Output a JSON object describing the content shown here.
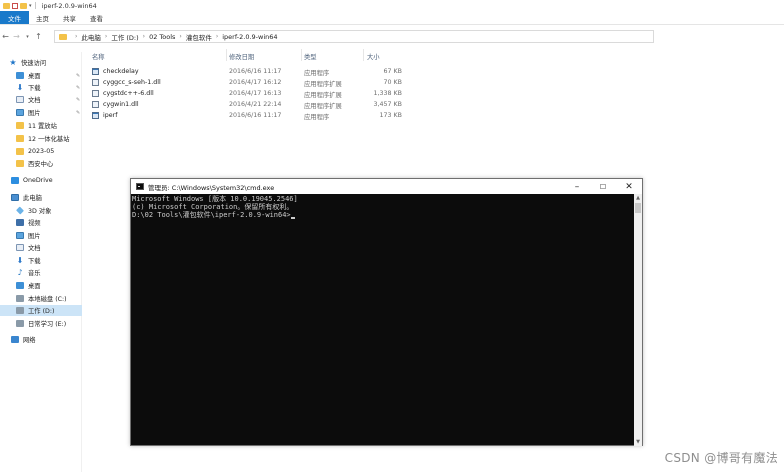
{
  "window": {
    "title": "iperf-2.0.9-win64"
  },
  "ribbon": {
    "tabs": [
      "文件",
      "主页",
      "共享",
      "查看"
    ]
  },
  "address": {
    "crumbs": [
      "此电脑",
      "工作 (D:)",
      "02 Tools",
      "灌包软件",
      "iperf-2.0.9-win64"
    ]
  },
  "sidebar": {
    "items": [
      {
        "label": "快速访问",
        "icon": "star-icon"
      },
      {
        "label": "桌面",
        "icon": "desktop-icon",
        "pinned": true
      },
      {
        "label": "下载",
        "icon": "download-icon",
        "pinned": true
      },
      {
        "label": "文档",
        "icon": "document-icon",
        "pinned": true
      },
      {
        "label": "图片",
        "icon": "picture-icon",
        "pinned": true
      },
      {
        "label": "11 置放站",
        "icon": "folder-icon"
      },
      {
        "label": "12 一体化基站",
        "icon": "folder-icon"
      },
      {
        "label": "2023-05",
        "icon": "folder-icon"
      },
      {
        "label": "西安中心",
        "icon": "folder-icon"
      },
      {
        "label": "OneDrive",
        "icon": "cloud-icon"
      },
      {
        "label": "此电脑",
        "icon": "computer-icon"
      },
      {
        "label": "3D 对象",
        "icon": "3d-objects-icon"
      },
      {
        "label": "视频",
        "icon": "video-icon"
      },
      {
        "label": "图片",
        "icon": "picture-icon"
      },
      {
        "label": "文档",
        "icon": "document-icon"
      },
      {
        "label": "下载",
        "icon": "download-icon"
      },
      {
        "label": "音乐",
        "icon": "music-icon"
      },
      {
        "label": "桌面",
        "icon": "desktop-icon"
      },
      {
        "label": "本地磁盘 (C:)",
        "icon": "drive-icon"
      },
      {
        "label": "工作 (D:)",
        "icon": "drive-icon",
        "selected": true
      },
      {
        "label": "日常学习 (E:)",
        "icon": "drive-icon"
      },
      {
        "label": "网络",
        "icon": "network-icon"
      }
    ]
  },
  "filelist": {
    "headers": {
      "name": "名称",
      "date": "修改日期",
      "type": "类型",
      "size": "大小"
    },
    "rows": [
      {
        "name": "checkdelay",
        "date": "2016/6/16 11:17",
        "type": "应用程序",
        "size": "67 KB",
        "icon": "exe-icon"
      },
      {
        "name": "cyggcc_s-seh-1.dll",
        "date": "2016/4/17 16:12",
        "type": "应用程序扩展",
        "size": "70 KB",
        "icon": "dll-icon"
      },
      {
        "name": "cygstdc++-6.dll",
        "date": "2016/4/17 16:13",
        "type": "应用程序扩展",
        "size": "1,338 KB",
        "icon": "dll-icon"
      },
      {
        "name": "cygwin1.dll",
        "date": "2016/4/21 22:14",
        "type": "应用程序扩展",
        "size": "3,457 KB",
        "icon": "dll-icon"
      },
      {
        "name": "iperf",
        "date": "2016/6/16 11:17",
        "type": "应用程序",
        "size": "173 KB",
        "icon": "exe-icon"
      }
    ]
  },
  "cmd": {
    "title": "管理员: C:\\Windows\\System32\\cmd.exe",
    "lines": [
      "Microsoft Windows [版本 10.0.19045.2546]",
      "(c) Microsoft Corporation。保留所有权利。",
      "",
      "D:\\02 Tools\\灌包软件\\iperf-2.0.9-win64>"
    ]
  },
  "watermark": "CSDN @博哥有魔法"
}
